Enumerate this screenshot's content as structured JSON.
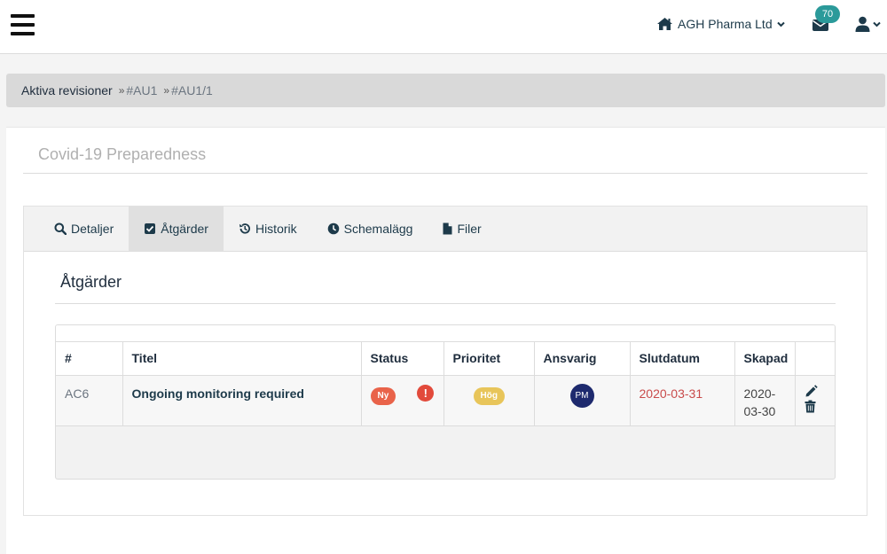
{
  "header": {
    "company": "AGH Pharma Ltd",
    "mail_count": "70"
  },
  "breadcrumb": {
    "items": [
      "Aktiva revisioner",
      "#AU1",
      "#AU1/1"
    ],
    "separator": "»"
  },
  "audit": {
    "title": "Covid-19 Preparedness"
  },
  "tabs": [
    {
      "label": "Detaljer",
      "icon": "search-icon"
    },
    {
      "label": "Åtgärder",
      "icon": "checkbox-icon",
      "active": true
    },
    {
      "label": "Historik",
      "icon": "history-icon"
    },
    {
      "label": "Schemalägg",
      "icon": "clock-icon"
    },
    {
      "label": "Filer",
      "icon": "file-icon"
    }
  ],
  "section": {
    "title": "Åtgärder"
  },
  "table": {
    "columns": [
      "#",
      "Titel",
      "Status",
      "Prioritet",
      "Ansvarig",
      "Slutdatum",
      "Skapad"
    ],
    "rows": [
      {
        "id": "AC6",
        "title": "Ongoing monitoring required",
        "status": "Ny",
        "status_alert": "!",
        "priority": "Hög",
        "responsible": "PM",
        "due": "2020-03-31",
        "created_line1": "2020-",
        "created_line2": "03-30"
      }
    ]
  },
  "colors": {
    "accent": "#2b9a9a",
    "status_new": "#e9634a",
    "priority_high": "#e8c55a",
    "overdue": "#c94b4b",
    "avatar": "#1e2a6e"
  }
}
